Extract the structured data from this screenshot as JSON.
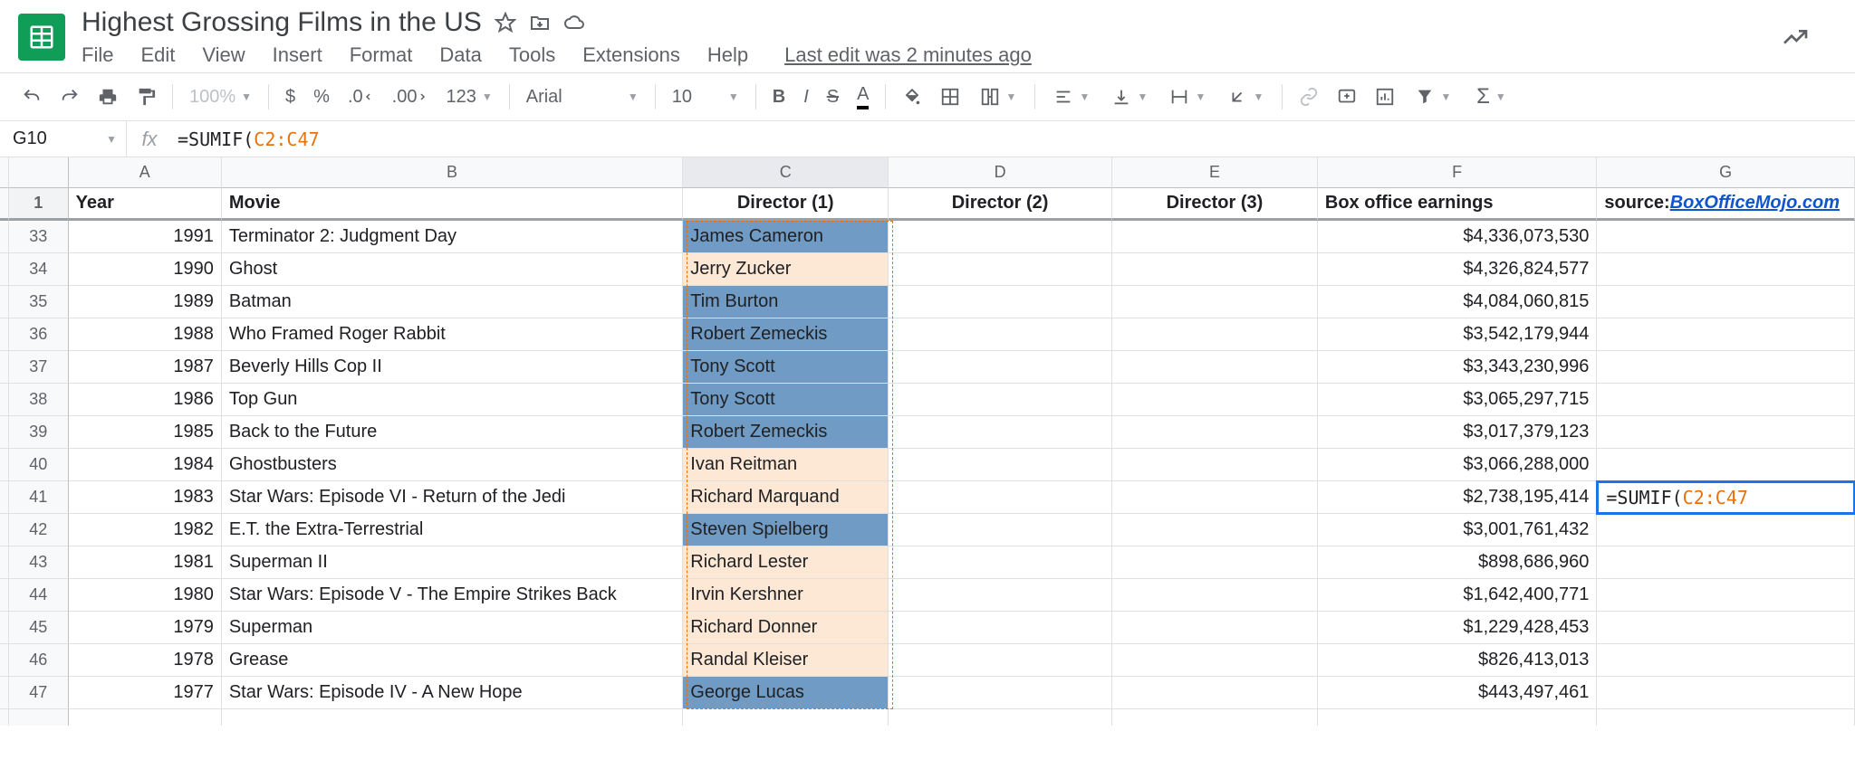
{
  "doc": {
    "title": "Highest Grossing Films in the US",
    "last_edit": "Last edit was 2 minutes ago"
  },
  "menu": {
    "file": "File",
    "edit": "Edit",
    "view": "View",
    "insert": "Insert",
    "format": "Format",
    "data": "Data",
    "tools": "Tools",
    "extensions": "Extensions",
    "help": "Help"
  },
  "toolbar": {
    "zoom": "100%",
    "font": "Arial",
    "size": "10",
    "currency": "$",
    "percent": "%",
    "dec_dec": ".0",
    "inc_dec": ".00",
    "fmt": "123"
  },
  "formula": {
    "cell_ref": "G10",
    "fx": "fx",
    "prefix": "=SUMIF(",
    "range": "C2:C47"
  },
  "columns": {
    "A": "A",
    "B": "B",
    "C": "C",
    "D": "D",
    "E": "E",
    "F": "F",
    "G": "G"
  },
  "headers": {
    "year": "Year",
    "movie": "Movie",
    "d1": "Director (1)",
    "d2": "Director (2)",
    "d3": "Director (3)",
    "box": "Box office earnings",
    "src_prefix": "source: ",
    "src_link": "BoxOfficeMojo.com"
  },
  "active": {
    "tag": "G10",
    "prefix": "=SUMIF(",
    "range": "C2:C47"
  },
  "rows": [
    {
      "n": "33",
      "year": "1991",
      "movie": "Terminator 2: Judgment Day",
      "dir": "James Cameron",
      "hl": "blue",
      "box": "$4,336,073,530"
    },
    {
      "n": "34",
      "year": "1990",
      "movie": "Ghost",
      "dir": "Jerry Zucker",
      "hl": "cream",
      "box": "$4,326,824,577"
    },
    {
      "n": "35",
      "year": "1989",
      "movie": "Batman",
      "dir": "Tim Burton",
      "hl": "blue",
      "box": "$4,084,060,815"
    },
    {
      "n": "36",
      "year": "1988",
      "movie": "Who Framed Roger Rabbit",
      "dir": "Robert Zemeckis",
      "hl": "blue",
      "box": "$3,542,179,944"
    },
    {
      "n": "37",
      "year": "1987",
      "movie": "Beverly Hills Cop II",
      "dir": "Tony Scott",
      "hl": "blue",
      "box": "$3,343,230,996"
    },
    {
      "n": "38",
      "year": "1986",
      "movie": "Top Gun",
      "dir": "Tony Scott",
      "hl": "blue",
      "box": "$3,065,297,715"
    },
    {
      "n": "39",
      "year": "1985",
      "movie": "Back to the Future",
      "dir": "Robert Zemeckis",
      "hl": "blue",
      "box": "$3,017,379,123"
    },
    {
      "n": "40",
      "year": "1984",
      "movie": "Ghostbusters",
      "dir": "Ivan Reitman",
      "hl": "cream",
      "box": "$3,066,288,000"
    },
    {
      "n": "41",
      "year": "1983",
      "movie": "Star Wars: Episode VI - Return of the Jedi",
      "dir": "Richard Marquand",
      "hl": "cream",
      "box": "$2,738,195,414"
    },
    {
      "n": "42",
      "year": "1982",
      "movie": "E.T. the Extra-Terrestrial",
      "dir": "Steven Spielberg",
      "hl": "blue",
      "box": "$3,001,761,432"
    },
    {
      "n": "43",
      "year": "1981",
      "movie": "Superman II",
      "dir": "Richard Lester",
      "hl": "cream",
      "box": "$898,686,960"
    },
    {
      "n": "44",
      "year": "1980",
      "movie": "Star Wars: Episode V - The Empire Strikes Back",
      "dir": "Irvin Kershner",
      "hl": "cream",
      "box": "$1,642,400,771"
    },
    {
      "n": "45",
      "year": "1979",
      "movie": "Superman",
      "dir": "Richard Donner",
      "hl": "cream",
      "box": "$1,229,428,453"
    },
    {
      "n": "46",
      "year": "1978",
      "movie": "Grease",
      "dir": "Randal Kleiser",
      "hl": "cream",
      "box": "$826,413,013"
    },
    {
      "n": "47",
      "year": "1977",
      "movie": "Star Wars: Episode IV - A New Hope",
      "dir": "George Lucas",
      "hl": "blue",
      "box": "$443,497,461"
    }
  ]
}
